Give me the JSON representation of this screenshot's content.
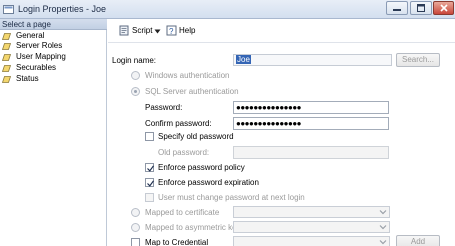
{
  "window": {
    "title": "Login Properties - Joe",
    "icon": "login-properties-icon"
  },
  "left": {
    "header": "Select a page",
    "items": [
      {
        "label": "General",
        "icon": "page-icon"
      },
      {
        "label": "Server Roles",
        "icon": "page-icon"
      },
      {
        "label": "User Mapping",
        "icon": "page-icon"
      },
      {
        "label": "Securables",
        "icon": "page-icon"
      },
      {
        "label": "Status",
        "icon": "page-icon"
      }
    ]
  },
  "toolbar": {
    "script_label": "Script",
    "help_label": "Help"
  },
  "form": {
    "login_name_label": "Login name:",
    "login_name_value": "Joe",
    "search_label": "Search...",
    "windows_auth_label": "Windows authentication",
    "sql_auth_label": "SQL Server authentication",
    "password_label": "Password:",
    "password_value": "●●●●●●●●●●●●●●●",
    "confirm_password_label": "Confirm password:",
    "confirm_password_value": "●●●●●●●●●●●●●●●",
    "specify_old_password_label": "Specify old password",
    "old_password_label": "Old password:",
    "enforce_policy_label": "Enforce password policy",
    "enforce_expiration_label": "Enforce password expiration",
    "must_change_label": "User must change password at next login",
    "mapped_certificate_label": "Mapped to certificate",
    "mapped_asymmetric_label": "Mapped to asymmetric key",
    "map_credential_label": "Map to Credential",
    "add_label": "Add"
  },
  "colors": {
    "selection": "#3465b5",
    "titlebar": "#d3dfef"
  }
}
